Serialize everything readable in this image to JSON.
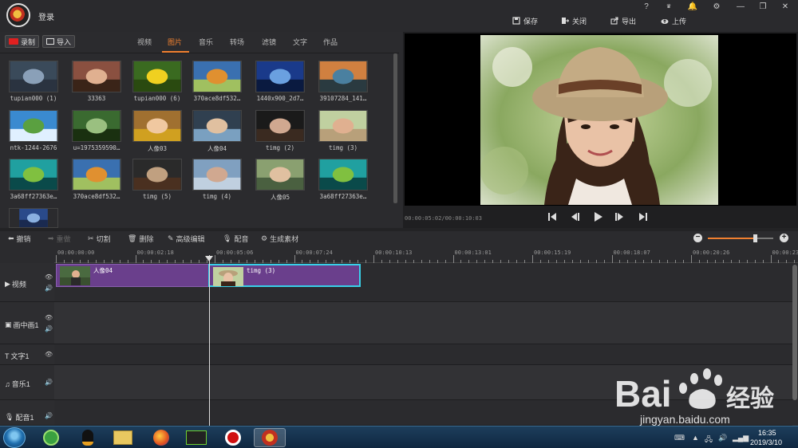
{
  "header": {
    "login_label": "登录",
    "window_controls": [
      "?",
      "VIP",
      "bell-icon",
      "gear-icon",
      "—",
      "❐",
      "✕"
    ],
    "actions": [
      {
        "label": "保存",
        "icon": "save-icon"
      },
      {
        "label": "关闭",
        "icon": "close-door-icon"
      },
      {
        "label": "导出",
        "icon": "export-icon"
      },
      {
        "label": "上传",
        "icon": "upload-cloud-icon"
      }
    ]
  },
  "library": {
    "record_label": "录制",
    "import_label": "导入",
    "tabs": [
      "视频",
      "图片",
      "音乐",
      "转场",
      "滤镜",
      "文字",
      "作品"
    ],
    "active_tab": "图片",
    "items": [
      {
        "label": "tupian000 (1)"
      },
      {
        "label": "33363"
      },
      {
        "label": "tupian000 (6)"
      },
      {
        "label": "370ace8df532…"
      },
      {
        "label": "1440x900_2d7…"
      },
      {
        "label": "39107284_141…"
      },
      {
        "label": "ntk-1244-2676"
      },
      {
        "label": "u=1975359590…"
      },
      {
        "label": "人像03"
      },
      {
        "label": "人像04"
      },
      {
        "label": "timg (2)"
      },
      {
        "label": "timg (3)"
      },
      {
        "label": "3a68ff27363e…"
      },
      {
        "label": "370ace8df532…"
      },
      {
        "label": "timg (5)"
      },
      {
        "label": "timg (4)"
      },
      {
        "label": "人像05"
      },
      {
        "label": "3a68ff27363e…"
      },
      {
        "label": ""
      }
    ]
  },
  "preview": {
    "timecode": "00:00:05:02/00:00:10:03"
  },
  "toolbar": {
    "undo": "撤销",
    "redo": "重做",
    "cut": "切割",
    "delete": "删除",
    "advanced_edit": "高级编辑",
    "dub": "配音",
    "generate": "生成素材",
    "zoom_level": 0.72
  },
  "timeline": {
    "ruler": [
      "00:00:00:00",
      "00:00:02:18",
      "00:00:05:06",
      "00:00:07:24",
      "00:00:10:13",
      "00:00:13:01",
      "00:00:15:19",
      "00:00:18:07",
      "00:00:20:26",
      "00:00:23:"
    ],
    "tracks": [
      {
        "name": "视频",
        "icon": "play-icon"
      },
      {
        "name": "画中画1",
        "icon": "pip-icon"
      },
      {
        "name": "文字1",
        "icon": "text-icon"
      },
      {
        "name": "音乐1",
        "icon": "music-icon"
      },
      {
        "name": "配音1",
        "icon": "mic-icon"
      }
    ],
    "clips": [
      {
        "label": "人像04"
      },
      {
        "label": "timg (3)"
      }
    ]
  },
  "taskbar": {
    "time": "16:35",
    "date": "2019/3/10"
  },
  "watermark": {
    "brand": "Bai 经验",
    "url": "jingyan.baidu.com"
  }
}
